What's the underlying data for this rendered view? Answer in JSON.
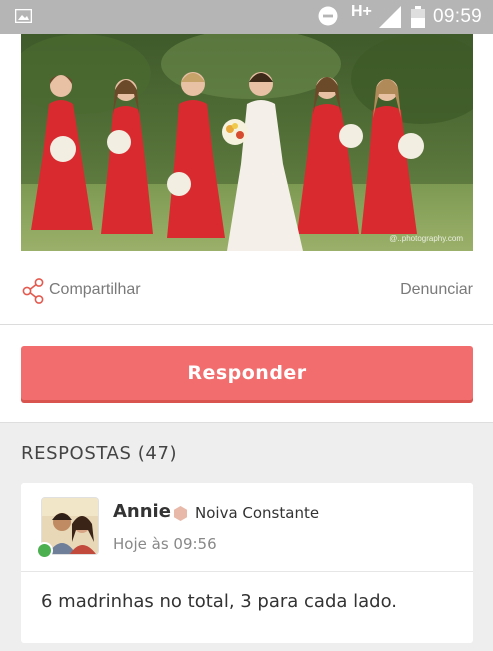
{
  "status_bar": {
    "network": "H+",
    "time": "09:59",
    "icons": [
      "image-icon",
      "do-not-disturb-icon",
      "signal-icon",
      "battery-icon"
    ]
  },
  "photo": {
    "watermark": "@..photography.com"
  },
  "actions": {
    "share_label": "Compartilhar",
    "report_label": "Denunciar"
  },
  "reply_button": {
    "label": "Responder"
  },
  "answers": {
    "title": "RESPOSTAS (47)",
    "items": [
      {
        "author": "Annie",
        "badge": "Noiva Constante",
        "time": "Hoje às 09:56",
        "text": "6 madrinhas no total, 3 para cada lado."
      }
    ]
  },
  "colors": {
    "accent": "#f26d6d",
    "status_bar": "#b5b5b5",
    "online": "#4caf50",
    "badge": "#e8b9a8"
  }
}
